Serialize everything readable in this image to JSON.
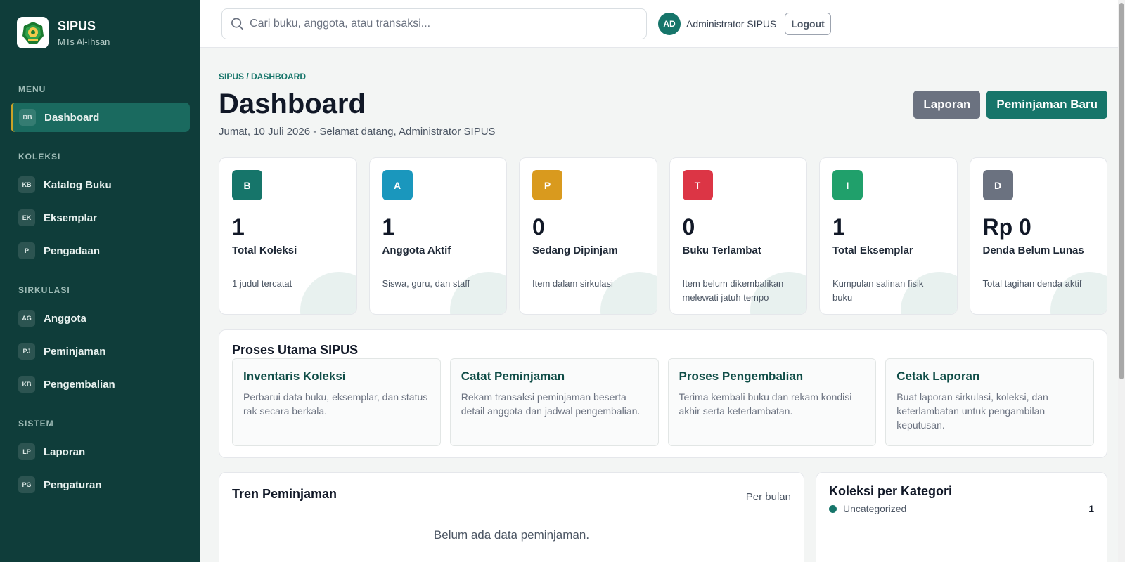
{
  "brand": {
    "title": "SIPUS",
    "subtitle": "MTs Al-Ihsan"
  },
  "sidebar": {
    "sections": [
      {
        "label": "MENU",
        "items": [
          {
            "badge": "DB",
            "label": "Dashboard",
            "active": true
          }
        ]
      },
      {
        "label": "KOLEKSI",
        "items": [
          {
            "badge": "KB",
            "label": "Katalog Buku"
          },
          {
            "badge": "EK",
            "label": "Eksemplar"
          },
          {
            "badge": "P",
            "label": "Pengadaan"
          }
        ]
      },
      {
        "label": "SIRKULASI",
        "items": [
          {
            "badge": "AG",
            "label": "Anggota"
          },
          {
            "badge": "PJ",
            "label": "Peminjaman"
          },
          {
            "badge": "KB",
            "label": "Pengembalian"
          }
        ]
      },
      {
        "label": "SISTEM",
        "items": [
          {
            "badge": "LP",
            "label": "Laporan"
          },
          {
            "badge": "PG",
            "label": "Pengaturan"
          }
        ]
      }
    ]
  },
  "topbar": {
    "search_placeholder": "Cari buku, anggota, atau transaksi...",
    "user_initials": "AD",
    "user_name": "Administrator SIPUS",
    "logout_label": "Logout"
  },
  "header": {
    "breadcrumb": "SIPUS / DASHBOARD",
    "title": "Dashboard",
    "subtitle": "Jumat, 10 Juli 2026 - Selamat datang, Administrator SIPUS",
    "report_button": "Laporan",
    "new_loan_button": "Peminjaman Baru"
  },
  "stats": [
    {
      "icon": "B",
      "color": "#16756a",
      "value": "1",
      "label": "Total Koleksi",
      "desc": "1 judul tercatat"
    },
    {
      "icon": "A",
      "color": "#1a97bd",
      "value": "1",
      "label": "Anggota Aktif",
      "desc": "Siswa, guru, dan staff"
    },
    {
      "icon": "P",
      "color": "#d99a1e",
      "value": "0",
      "label": "Sedang Dipinjam",
      "desc": "Item dalam sirkulasi"
    },
    {
      "icon": "T",
      "color": "#dc3545",
      "value": "0",
      "label": "Buku Terlambat",
      "desc": "Item belum dikembalikan melewati jatuh tempo"
    },
    {
      "icon": "I",
      "color": "#20a06b",
      "value": "1",
      "label": "Total Eksemplar",
      "desc": "Kumpulan salinan fisik buku"
    },
    {
      "icon": "D",
      "color": "#6b7280",
      "value": "Rp 0",
      "label": "Denda Belum Lunas",
      "desc": "Total tagihan denda aktif"
    }
  ],
  "process": {
    "title": "Proses Utama SIPUS",
    "cards": [
      {
        "title": "Inventaris Koleksi",
        "desc": "Perbarui data buku, eksemplar, dan status rak secara berkala."
      },
      {
        "title": "Catat Peminjaman",
        "desc": "Rekam transaksi peminjaman beserta detail anggota dan jadwal pengembalian."
      },
      {
        "title": "Proses Pengembalian",
        "desc": "Terima kembali buku dan rekam kondisi akhir serta keterlambatan."
      },
      {
        "title": "Cetak Laporan",
        "desc": "Buat laporan sirkulasi, koleksi, dan keterlambatan untuk pengambilan keputusan."
      }
    ]
  },
  "trend": {
    "title": "Tren Peminjaman",
    "period": "Per bulan",
    "empty": "Belum ada data peminjaman."
  },
  "category": {
    "title": "Koleksi per Kategori",
    "items": [
      {
        "label": "Uncategorized",
        "count": "1",
        "color": "#16756a"
      }
    ]
  }
}
